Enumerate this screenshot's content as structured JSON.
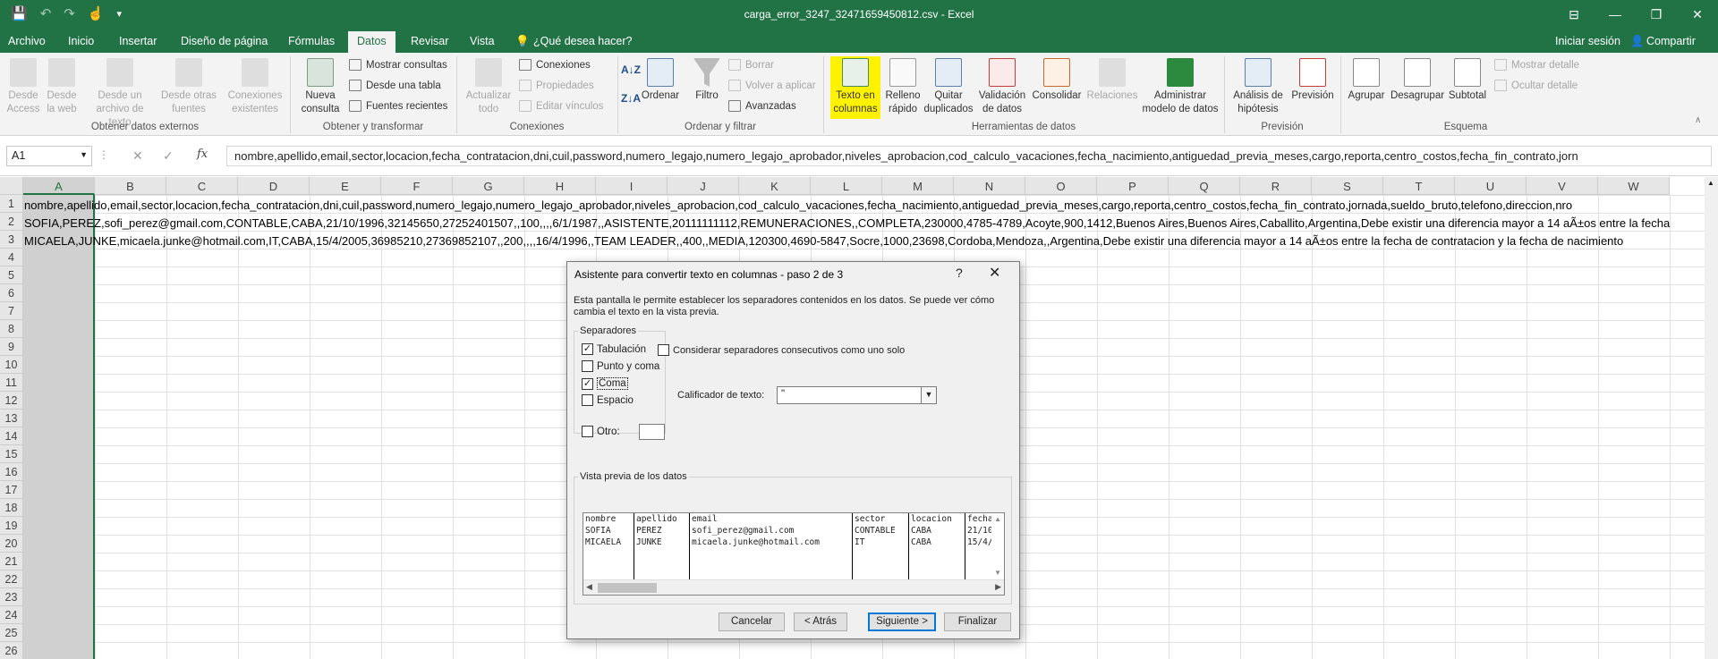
{
  "window": {
    "title": "carga_error_3247_32471659450812.csv - Excel",
    "controls": [
      "⊟",
      "—",
      "❐",
      "✕"
    ]
  },
  "qat": {
    "save": "💾",
    "undo": "↶",
    "redo": "↷",
    "touch": "☝",
    "more": "▾"
  },
  "tabs": [
    {
      "label": "Archivo"
    },
    {
      "label": "Inicio"
    },
    {
      "label": "Insertar"
    },
    {
      "label": "Diseño de página"
    },
    {
      "label": "Fórmulas"
    },
    {
      "label": "Datos"
    },
    {
      "label": "Revisar"
    },
    {
      "label": "Vista"
    },
    {
      "label": "¿Qué desea hacer?"
    }
  ],
  "account": {
    "signin": "Iniciar sesión",
    "share": "Compartir"
  },
  "ribbon": {
    "groups": [
      "Obtener datos externos",
      "Obtener y transformar",
      "Conexiones",
      "Ordenar y filtrar",
      "Herramientas de datos",
      "Previsión",
      "Esquema"
    ],
    "external": [
      "Desde Access",
      "Desde la web",
      "Desde un archivo de texto",
      "Desde otras fuentes",
      "Conexiones existentes"
    ],
    "new_query": "Nueva consulta",
    "transform_small": [
      "Mostrar consultas",
      "Desde una tabla",
      "Fuentes recientes"
    ],
    "refresh": "Actualizar todo",
    "connections_small": [
      "Conexiones",
      "Propiedades",
      "Editar vínculos"
    ],
    "sort_small": "Ordenar",
    "filter": "Filtro",
    "filter_small": [
      "Borrar",
      "Volver a aplicar",
      "Avanzadas"
    ],
    "tools": [
      "Texto en columnas",
      "Relleno rápido",
      "Quitar duplicados",
      "Validación de datos",
      "Consolidar",
      "Relaciones",
      "Administrar modelo de datos"
    ],
    "forecast": [
      "Análisis de hipótesis",
      "Previsión"
    ],
    "outline": [
      "Agrupar",
      "Desagrupar",
      "Subtotal"
    ],
    "outline_small": [
      "Mostrar detalle",
      "Ocultar detalle"
    ]
  },
  "formula_bar": {
    "cell_ref": "A1",
    "fx": "fx",
    "content": "nombre,apellido,email,sector,locacion,fecha_contratacion,dni,cuil,password,numero_legajo,numero_legajo_aprobador,niveles_aprobacion,cod_calculo_vacaciones,fecha_nacimiento,antiguedad_previa_meses,cargo,reporta,centro_costos,fecha_fin_contrato,jorn"
  },
  "sheet": {
    "columns": [
      "A",
      "B",
      "C",
      "D",
      "E",
      "F",
      "G",
      "H",
      "I",
      "J",
      "K",
      "L",
      "M",
      "N",
      "O",
      "P",
      "Q",
      "R",
      "S",
      "T",
      "U",
      "V",
      "W"
    ],
    "rows": [
      "1",
      "2",
      "3",
      "4",
      "5",
      "6",
      "7",
      "8",
      "9",
      "10",
      "11",
      "12",
      "13",
      "14",
      "15",
      "16",
      "17",
      "18",
      "19",
      "20",
      "21",
      "22",
      "23",
      "24",
      "25",
      "26"
    ],
    "cells": [
      "nombre,apellido,email,sector,locacion,fecha_contratacion,dni,cuil,password,numero_legajo,numero_legajo_aprobador,niveles_aprobacion,cod_calculo_vacaciones,fecha_nacimiento,antiguedad_previa_meses,cargo,reporta,centro_costos,fecha_fin_contrato,jornada,sueldo_bruto,telefono,direccion,nro",
      "SOFIA,PEREZ,sofi_perez@gmail.com,CONTABLE,CABA,21/10/1996,32145650,27252401507,,100,,,,6/1/1987,,ASISTENTE,20111111112,REMUNERACIONES,,COMPLETA,230000,4785-4789,Acoyte,900,1412,Buenos Aires,Buenos Aires,Caballito,Argentina,Debe existir una diferencia mayor a 14 aÃ±os entre la fecha",
      "MICAELA,JUNKE,micaela.junke@hotmail.com,IT,CABA,15/4/2005,36985210,27369852107,,200,,,,16/4/1996,,TEAM LEADER,,400,,MEDIA,120300,4690-5847,Socre,1000,23698,Cordoba,Mendoza,,Argentina,Debe existir una diferencia mayor a 14 aÃ±os entre la fecha de contratacion y la fecha de nacimiento"
    ]
  },
  "dialog": {
    "title": "Asistente para convertir texto en columnas - paso 2 de 3",
    "help": "?",
    "close": "✕",
    "description": "Esta pantalla le permite establecer los separadores contenidos en los datos. Se puede ver cómo cambia el texto en la vista previa.",
    "separators_legend": "Separadores",
    "separators": [
      {
        "label": "Tabulación",
        "checked": "✓"
      },
      {
        "label": "Punto y coma",
        "checked": ""
      },
      {
        "label": "Coma",
        "checked": "✓"
      },
      {
        "label": "Espacio",
        "checked": ""
      },
      {
        "label": "Otro:",
        "checked": ""
      }
    ],
    "consecutive": {
      "label": "Considerar separadores consecutivos como uno solo",
      "checked": ""
    },
    "qualifier_label": "Calificador de texto:",
    "qualifier_value": "\"",
    "preview_legend": "Vista previa de los datos",
    "preview_columns": [
      [
        "nombre",
        "SOFIA",
        "MICAELA"
      ],
      [
        "apellido",
        "PEREZ",
        "JUNKE"
      ],
      [
        "email",
        "sofi_perez@gmail.com",
        "micaela.junke@hotmail.com"
      ],
      [
        "sector",
        "CONTABLE",
        "IT"
      ],
      [
        "locacion",
        "CABA",
        "CABA"
      ],
      [
        "fecha",
        "21/10",
        "15/4/"
      ]
    ],
    "buttons": {
      "cancel": "Cancelar",
      "back": "< Atrás",
      "next": "Siguiente >",
      "finish": "Finalizar"
    }
  },
  "colors": {
    "excel_green": "#217346",
    "selection_blue": "#0078d7",
    "highlight_yellow": "#fff200"
  }
}
